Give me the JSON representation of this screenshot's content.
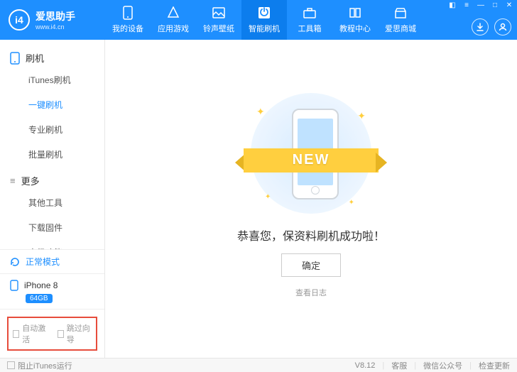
{
  "app": {
    "name": "爱思助手",
    "url": "www.i4.cn",
    "logo_letters": "i4"
  },
  "nav": [
    {
      "label": "我的设备"
    },
    {
      "label": "应用游戏"
    },
    {
      "label": "铃声壁纸"
    },
    {
      "label": "智能刷机",
      "active": true
    },
    {
      "label": "工具箱"
    },
    {
      "label": "教程中心"
    },
    {
      "label": "爱思商城"
    }
  ],
  "sidebar": {
    "group1": {
      "title": "刷机",
      "items": [
        "iTunes刷机",
        "一键刷机",
        "专业刷机",
        "批量刷机"
      ],
      "active_index": 1
    },
    "group2": {
      "title": "更多",
      "items": [
        "其他工具",
        "下载固件",
        "高级功能"
      ]
    },
    "status": "正常模式",
    "device": {
      "name": "iPhone 8",
      "storage": "64GB"
    },
    "checks": {
      "auto_activate": "自动激活",
      "skip_guide": "跳过向导"
    }
  },
  "main": {
    "ribbon": "NEW",
    "success": "恭喜您，保资料刷机成功啦！",
    "ok": "确定",
    "log": "查看日志"
  },
  "footer": {
    "block_itunes": "阻止iTunes运行",
    "version": "V8.12",
    "support": "客服",
    "wechat": "微信公众号",
    "update": "检查更新"
  }
}
